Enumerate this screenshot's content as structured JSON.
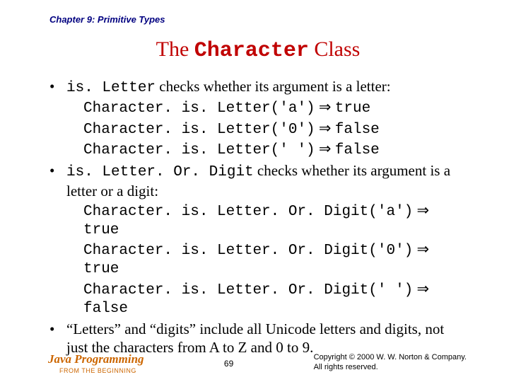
{
  "chapter": "Chapter 9: Primitive Types",
  "title_pre": "The ",
  "title_code": "Character",
  "title_post": " Class",
  "bullets": {
    "b1_pre": "is. Letter",
    "b1_post": " checks whether its argument is a letter:",
    "ex1a": "Character. is. Letter('a')",
    "ex1a_r": "true",
    "ex1b": "Character. is. Letter('0')",
    "ex1b_r": "false",
    "ex1c": "Character. is. Letter(' ')",
    "ex1c_r": "false",
    "b2_pre": "is. Letter. Or. Digit",
    "b2_post": " checks whether its argument is a letter or a digit:",
    "ex2a": "Character. is. Letter. Or. Digit('a')",
    "ex2a_r": "true",
    "ex2b": "Character. is. Letter. Or. Digit('0')",
    "ex2b_r": "true",
    "ex2c": "Character. is. Letter. Or. Digit(' ')",
    "ex2c_r": "false",
    "b3": "“Letters” and “digits” include all Unicode letters and digits, not just the characters from A to Z and 0 to 9."
  },
  "arrow": " ⇒ ",
  "footer": {
    "left_main": "Java Programming",
    "left_sub": "FROM THE BEGINNING",
    "page": "69",
    "copyright1": "Copyright © 2000 W. W. Norton & Company.",
    "copyright2": "All rights reserved."
  }
}
